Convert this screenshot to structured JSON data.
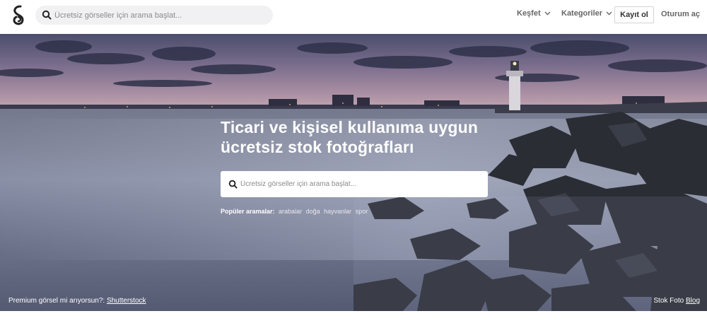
{
  "header": {
    "search_placeholder": "Ücretsiz görseller için arama başlat...",
    "nav": {
      "explore_label": "Keşfet",
      "categories_label": "Kategoriler",
      "signup_label": "Kayıt ol",
      "login_label": "Oturum aç"
    }
  },
  "hero": {
    "title_line1": "Ticari ve kişisel kullanıma uygun",
    "title_line2": "ücretsiz stok fotoğrafları",
    "search_placeholder": "Ücretsiz görseller için arama başlat...",
    "popular_label": "Popüler aramalar:",
    "popular_tags": [
      "arabalar",
      "doğa",
      "hayvanlar",
      "spor"
    ],
    "premium_text": "Premium görsel mi arıyorsun?:",
    "premium_link": "Shutterstock",
    "blog_text": "Stok Foto",
    "blog_link": "Blog"
  },
  "icons": {
    "logo": "logo-icon",
    "search": "search-icon",
    "dropdown": "chevron-down-icon"
  },
  "colors": {
    "sky_top": "#4d4f6e",
    "sky_horizon": "#a88aa0",
    "water": "#6e7488",
    "rocks": "#2a2c33"
  }
}
